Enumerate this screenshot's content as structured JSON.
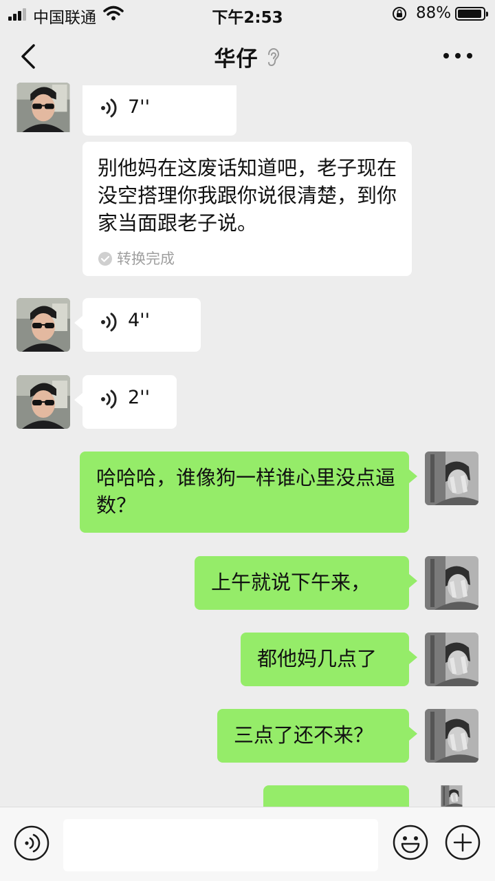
{
  "status_bar": {
    "carrier": "中国联通",
    "time": "下午2:53",
    "battery": "88%",
    "battery_level": 0.88,
    "icons": [
      "signal-icon",
      "wifi-icon",
      "rotation-lock-icon",
      "battery-icon"
    ]
  },
  "nav": {
    "title": "华仔",
    "back_icon": "chevron-left-icon",
    "ear_icon": "ear-icon",
    "more_icon": "more-icon"
  },
  "messages": [
    {
      "sender": "contact",
      "type": "voice",
      "duration": "7''"
    },
    {
      "sender": "contact",
      "type": "transcript",
      "text": "别他妈在这废话知道吧，老子现在没空搭理你我跟你说很清楚，到你家当面跟老子说。",
      "status": "转换完成"
    },
    {
      "sender": "contact",
      "type": "voice",
      "duration": "4''"
    },
    {
      "sender": "contact",
      "type": "voice",
      "duration": "2''"
    },
    {
      "sender": "me",
      "type": "text",
      "text": "哈哈哈，谁像狗一样谁心里没点逼数？"
    },
    {
      "sender": "me",
      "type": "text",
      "text": "上午就说下午来，"
    },
    {
      "sender": "me",
      "type": "text",
      "text": "都他妈几点了"
    },
    {
      "sender": "me",
      "type": "text",
      "text": "三点了还不来？"
    }
  ],
  "input_bar": {
    "placeholder": "",
    "icons": [
      "voice-mode-icon",
      "emoji-icon",
      "plus-icon"
    ]
  },
  "colors": {
    "background": "#ededed",
    "incoming_bubble": "#ffffff",
    "outgoing_bubble": "#95ec69",
    "muted_text": "#9f9f9f"
  }
}
